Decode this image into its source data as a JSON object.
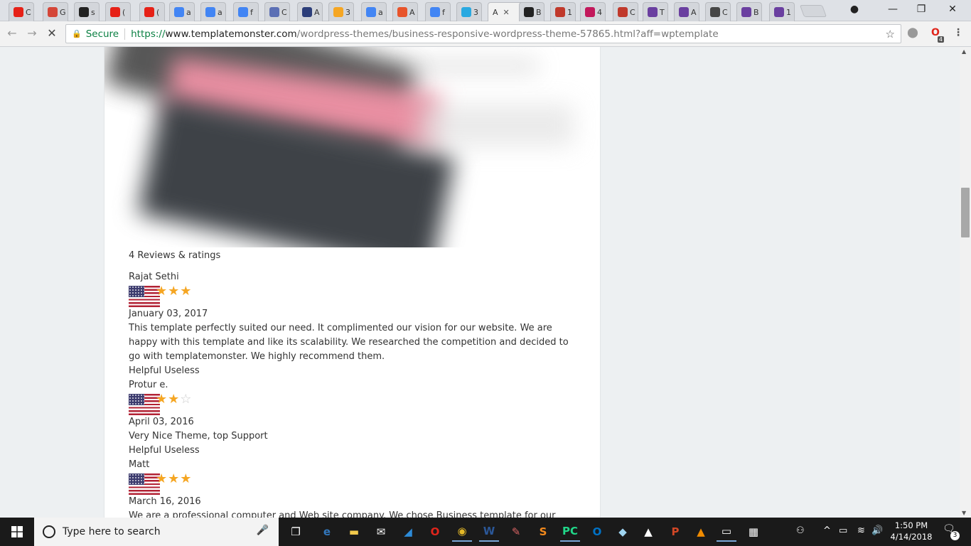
{
  "browser": {
    "tabs": [
      {
        "icon": "youtube-icon",
        "label": "C",
        "color": "#e62117"
      },
      {
        "icon": "gmail-icon",
        "label": "G",
        "color": "#d44638"
      },
      {
        "icon": "github-icon",
        "label": "s",
        "color": "#222222"
      },
      {
        "icon": "youtube-icon",
        "label": "(",
        "color": "#e62117"
      },
      {
        "icon": "youtube-icon",
        "label": "(",
        "color": "#e62117"
      },
      {
        "icon": "google-icon",
        "label": "a",
        "color": "#4285f4"
      },
      {
        "icon": "google-icon",
        "label": "a",
        "color": "#4285f4"
      },
      {
        "icon": "google-icon",
        "label": "f",
        "color": "#4285f4"
      },
      {
        "icon": "app-icon",
        "label": "C",
        "color": "#5b6fb5"
      },
      {
        "icon": "s-icon",
        "label": "A",
        "color": "#2c3e7a"
      },
      {
        "icon": "her-icon",
        "label": "3",
        "color": "#f5a623"
      },
      {
        "icon": "google-icon",
        "label": "a",
        "color": "#4285f4"
      },
      {
        "icon": "fire-icon",
        "label": "A",
        "color": "#e8542b"
      },
      {
        "icon": "google-icon",
        "label": "f",
        "color": "#4285f4"
      },
      {
        "icon": "t-icon",
        "label": "3",
        "color": "#29a9e1"
      },
      {
        "icon": "b-icon",
        "label": "B",
        "color": "#222222"
      },
      {
        "icon": "cc-icon",
        "label": "1",
        "color": "#c0392b"
      },
      {
        "icon": "w-icon",
        "label": "4",
        "color": "#c2185b"
      },
      {
        "icon": "s-red-icon",
        "label": "C",
        "color": "#c0392b"
      },
      {
        "icon": "colorlib-icon",
        "label": "T",
        "color": "#6a3fa0"
      },
      {
        "icon": "colorlib-icon",
        "label": "A",
        "color": "#6a3fa0"
      },
      {
        "icon": "wordpress-icon",
        "label": "C",
        "color": "#464646"
      },
      {
        "icon": "colorlib-icon",
        "label": "B",
        "color": "#6a3fa0"
      },
      {
        "icon": "colorlib-icon",
        "label": "1",
        "color": "#6a3fa0"
      }
    ],
    "active_tab": {
      "label": "A",
      "close": "✕"
    },
    "window_controls": {
      "profile": "●",
      "minimize": "—",
      "restore": "❐",
      "close": "✕"
    },
    "nav": {
      "back": "←",
      "forward": "→",
      "stop": "✕"
    },
    "address": {
      "lock": "🔒",
      "secure_label": "Secure",
      "scheme": "https://",
      "host": "www.templatemonster.com",
      "path": "/wordpress-themes/business-responsive-wordpress-theme-57865.html?aff=wptemplate",
      "star": "☆"
    },
    "extensions": {
      "ext1": "⬤",
      "ext2": "O",
      "menu": "⋮",
      "badge": "4"
    }
  },
  "reviews": {
    "heading": "4 Reviews & ratings",
    "items": [
      {
        "name": "Rajat Sethi",
        "rating": 3,
        "date": "January 03, 2017",
        "text": "This template perfectly suited our need. It complimented our vision for our website. We are happy with this template and like its scalability. We researched the competition and decided to go with templatemonster. We highly recommend them.",
        "helpful": "Helpful",
        "useless": "Useless"
      },
      {
        "name": "Protur e.",
        "rating": 2,
        "date": "April 03, 2016",
        "text": "Very Nice Theme, top Support",
        "helpful": "Helpful",
        "useless": "Useless"
      },
      {
        "name": "Matt",
        "rating": 3,
        "date": "March 16, 2016",
        "text": "We are a professional computer and Web site company. We chose Business template for our client who",
        "helpful": "Helpful",
        "useless": "Useless"
      }
    ]
  },
  "taskbar": {
    "search_placeholder": "Type here to search",
    "clock_time": "1:50 PM",
    "clock_date": "4/14/2018",
    "notification_count": "3",
    "apps": [
      {
        "icon": "task-view-icon",
        "glyph": "❐",
        "color": "#ffffff"
      },
      {
        "icon": "edge-icon",
        "glyph": "e",
        "color": "#3277bc"
      },
      {
        "icon": "file-explorer-icon",
        "glyph": "▬",
        "color": "#f2c94c"
      },
      {
        "icon": "mail-icon",
        "glyph": "✉",
        "color": "#ffffff"
      },
      {
        "icon": "azure-icon",
        "glyph": "◢",
        "color": "#2d8bd8"
      },
      {
        "icon": "opera-icon",
        "glyph": "O",
        "color": "#e0251b"
      },
      {
        "icon": "chrome-icon",
        "glyph": "◉",
        "color": "#e4b827"
      },
      {
        "icon": "word-icon",
        "glyph": "W",
        "color": "#2b5797"
      },
      {
        "icon": "paint-icon",
        "glyph": "✎",
        "color": "#d96464"
      },
      {
        "icon": "sublime-icon",
        "glyph": "S",
        "color": "#f48a1c"
      },
      {
        "icon": "pycharm-icon",
        "glyph": "PC",
        "color": "#21d789"
      },
      {
        "icon": "outlook-icon",
        "glyph": "O",
        "color": "#0072c6"
      },
      {
        "icon": "notes-icon",
        "glyph": "◆",
        "color": "#9fd4f0"
      },
      {
        "icon": "photos-icon",
        "glyph": "▲",
        "color": "#ffffff"
      },
      {
        "icon": "powerpoint-icon",
        "glyph": "P",
        "color": "#d24726"
      },
      {
        "icon": "vlc-icon",
        "glyph": "▲",
        "color": "#f08b00"
      },
      {
        "icon": "cmd-icon",
        "glyph": "▭",
        "color": "#ffffff"
      },
      {
        "icon": "clapper-icon",
        "glyph": "▦",
        "color": "#ffffff"
      }
    ],
    "tray": {
      "people": "⚇",
      "up": "^",
      "battery": "▭",
      "wifi": "≋",
      "volume": "🔊"
    }
  }
}
